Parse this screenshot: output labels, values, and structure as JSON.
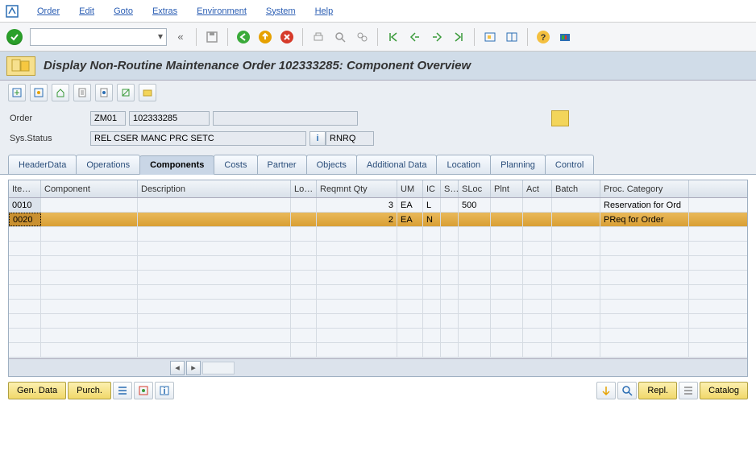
{
  "menu": {
    "items": [
      "Order",
      "Edit",
      "Goto",
      "Extras",
      "Environment",
      "System",
      "Help"
    ]
  },
  "title_bar": {
    "text": "Display Non-Routine Maintenance Order 102333285: Component Overview"
  },
  "header": {
    "order_label": "Order",
    "order_type": "ZM01",
    "order_number": "102333285",
    "status_label": "Sys.Status",
    "status_text": "REL   CSER  MANC  PRC   SETC",
    "status_right": "RNRQ",
    "info_label": "i"
  },
  "tabs": [
    "HeaderData",
    "Operations",
    "Components",
    "Costs",
    "Partner",
    "Objects",
    "Additional Data",
    "Location",
    "Planning",
    "Control"
  ],
  "active_tab": 2,
  "grid": {
    "columns": [
      "Ite…",
      "Component",
      "Description",
      "Lo…",
      "Reqmnt Qty",
      "UM",
      "IC",
      "S…",
      "SLoc",
      "Plnt",
      "Act",
      "Batch",
      "Proc. Category"
    ],
    "rows": [
      {
        "item": "0010",
        "component": "",
        "desc": "",
        "lo": "",
        "qty": "3",
        "um": "EA",
        "ic": "L",
        "s": "",
        "sloc": "500",
        "plnt": "",
        "act": "",
        "batch": "",
        "proc": "Reservation for Ord",
        "selected": false
      },
      {
        "item": "0020",
        "component": "",
        "desc": "",
        "lo": "",
        "qty": "2",
        "um": "EA",
        "ic": "N",
        "s": "",
        "sloc": "",
        "plnt": "",
        "act": "",
        "batch": "",
        "proc": "PReq for Order",
        "selected": true
      }
    ]
  },
  "footer": {
    "gen_data": "Gen. Data",
    "purch": "Purch.",
    "repl": "Repl.",
    "catalog": "Catalog"
  }
}
